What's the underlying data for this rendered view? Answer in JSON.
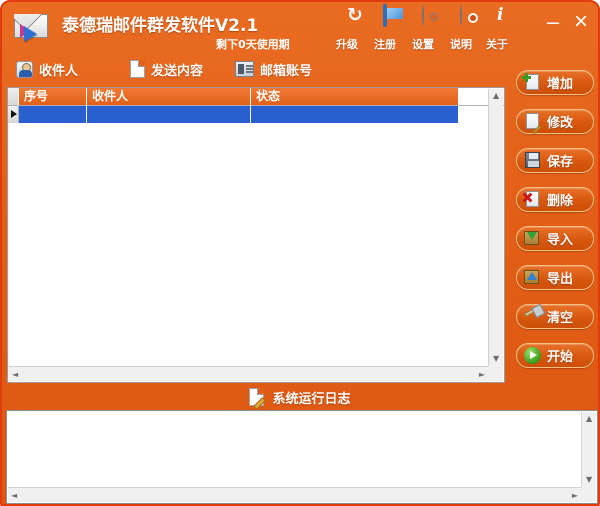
{
  "window": {
    "title": "泰德瑞邮件群发软件V2.1",
    "trial_notice": "剩下0天使用期",
    "logo_icon": "mail-envelope-icon",
    "minimize_label": "–",
    "close_label": "×",
    "accent_color": "#e0601a",
    "border_color": "#e03c0c",
    "selection_color": "#2a5fd0"
  },
  "toolbar": {
    "items": [
      {
        "label": "升级",
        "icon": "refresh-upgrade-icon"
      },
      {
        "label": "注册",
        "icon": "monitor-register-icon"
      },
      {
        "label": "设置",
        "icon": "gear-settings-icon"
      },
      {
        "label": "说明",
        "icon": "cd-help-icon"
      },
      {
        "label": "关于",
        "icon": "info-about-icon"
      }
    ]
  },
  "tabs": [
    {
      "label": "收件人",
      "icon": "person-icon",
      "active": true
    },
    {
      "label": "发送内容",
      "icon": "document-icon",
      "active": false
    },
    {
      "label": "邮箱账号",
      "icon": "id-card-icon",
      "active": false
    }
  ],
  "grid": {
    "columns": [
      "序号",
      "收件人",
      "状态"
    ],
    "rows": [
      {
        "selected": true,
        "cells": [
          "",
          "",
          ""
        ]
      }
    ],
    "scrollbars": {
      "v_up": "▲",
      "v_down": "▼",
      "h_left": "◄",
      "h_right": "►"
    }
  },
  "actions": [
    {
      "label": "增加",
      "icon": "add-document-icon"
    },
    {
      "label": "修改",
      "icon": "edit-pencil-icon"
    },
    {
      "label": "保存",
      "icon": "floppy-save-icon"
    },
    {
      "label": "删除",
      "icon": "delete-x-icon"
    },
    {
      "label": "导入",
      "icon": "import-down-arrow-icon"
    },
    {
      "label": "导出",
      "icon": "export-up-arrow-icon"
    },
    {
      "label": "清空",
      "icon": "broom-clear-icon"
    },
    {
      "label": "开始",
      "icon": "play-start-icon"
    }
  ],
  "log": {
    "title": "系统运行日志",
    "icon": "log-note-icon",
    "content": "",
    "scrollbars": {
      "v_up": "▲",
      "v_down": "▼",
      "h_left": "◄",
      "h_right": "►"
    }
  }
}
